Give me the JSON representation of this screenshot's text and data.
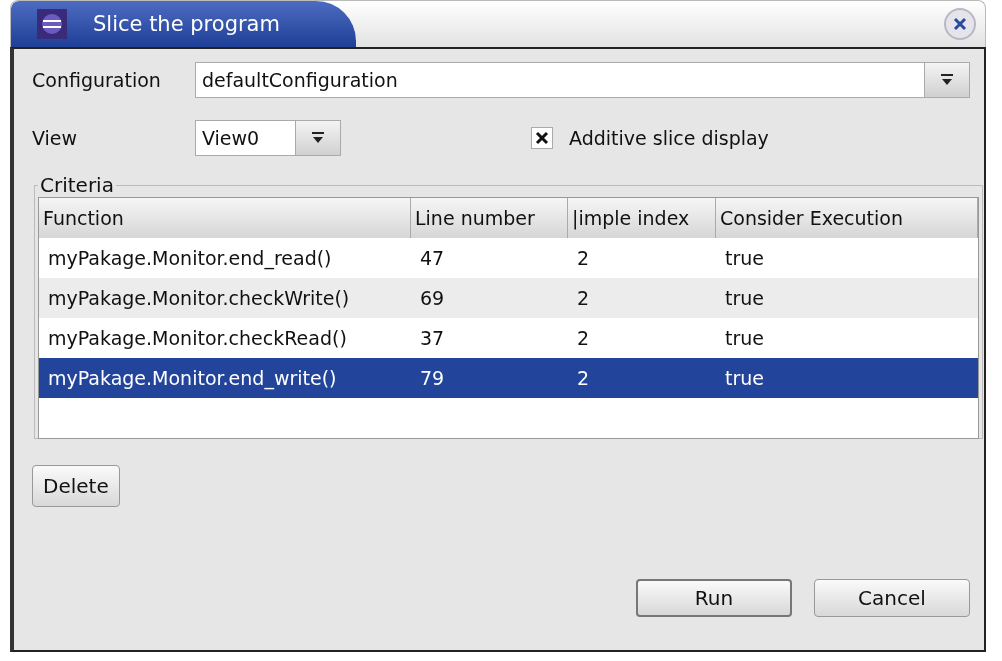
{
  "window": {
    "title": "Slice the program"
  },
  "configuration": {
    "label": "Configuration",
    "value": "defaultConfiguration"
  },
  "view": {
    "label": "View",
    "value": "View0"
  },
  "additive_slice_display": {
    "label": "Additive slice display",
    "checked": true
  },
  "criteria": {
    "title": "Criteria",
    "columns": [
      "Function",
      "Line number",
      "|imple index",
      "Consider Execution"
    ],
    "rows": [
      {
        "cells": [
          "myPakage.Monitor.end_read()",
          "47",
          "2",
          "true"
        ],
        "selected": false
      },
      {
        "cells": [
          "myPakage.Monitor.checkWrite()",
          "69",
          "2",
          "true"
        ],
        "selected": false
      },
      {
        "cells": [
          "myPakage.Monitor.checkRead()",
          "37",
          "2",
          "true"
        ],
        "selected": false
      },
      {
        "cells": [
          "myPakage.Monitor.end_write()",
          "79",
          "2",
          "true"
        ],
        "selected": true
      }
    ]
  },
  "buttons": {
    "delete": "Delete",
    "run": "Run",
    "cancel": "Cancel"
  }
}
